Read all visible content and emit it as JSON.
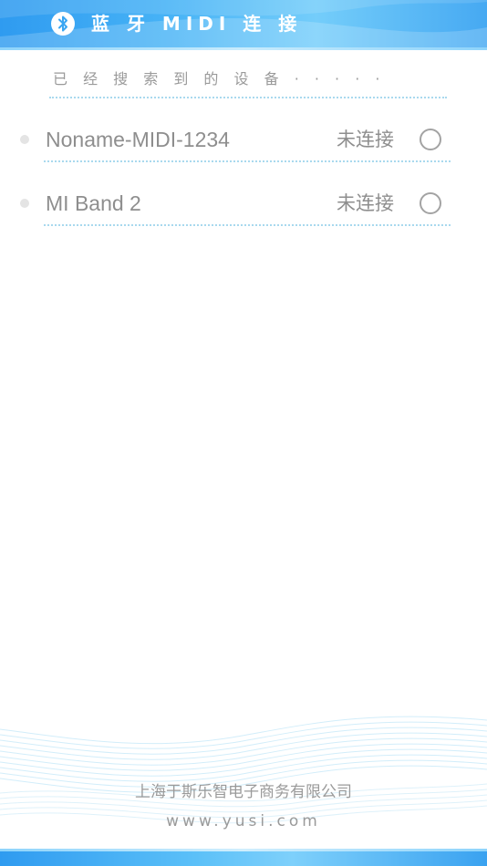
{
  "header": {
    "title": "蓝 牙 MIDI 连 接",
    "icon": "bluetooth-icon",
    "colors": {
      "primary": "#2f9bf0",
      "light": "#74cdfa"
    }
  },
  "devices_section": {
    "label": "已 经 搜 索 到 的 设 备 · · · · ·",
    "devices": [
      {
        "name": "Noname-MIDI-1234",
        "status": "未连接",
        "selected": false
      },
      {
        "name": "MI Band 2",
        "status": "未连接",
        "selected": false
      }
    ]
  },
  "footer": {
    "company": "上海于斯乐智电子商务有限公司",
    "url": "www.yusi.com"
  }
}
